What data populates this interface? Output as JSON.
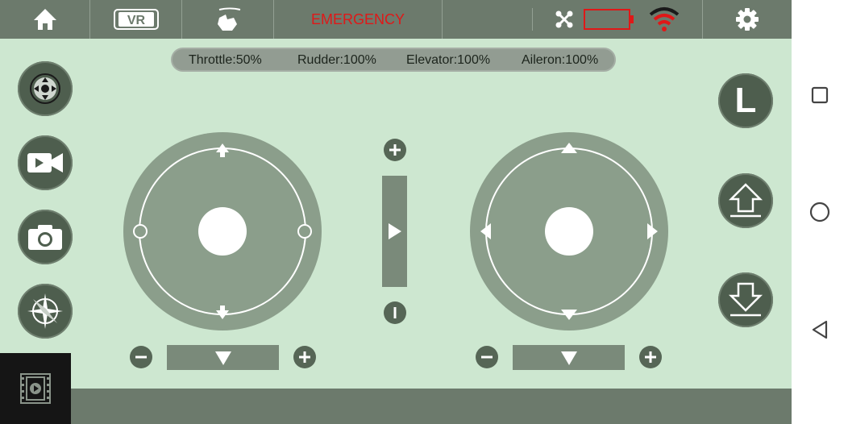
{
  "topbar": {
    "emergency_label": "EMERGENCY",
    "items": [
      "home-icon",
      "vr-icon",
      "gesture-icon",
      "drone-icon",
      "battery-icon",
      "wifi-icon",
      "settings-icon"
    ],
    "vr_label": "VR"
  },
  "status": {
    "throttle": "Throttle:50%",
    "rudder": "Rudder:100%",
    "elevator": "Elevator:100%",
    "aileron": "Aileron:100%"
  },
  "right_buttons": {
    "mode_label": "L"
  },
  "colors": {
    "background": "#cde7d0",
    "bar": "#6c7a6c",
    "button": "#4e5e4e",
    "joystick": "#8b9e8b",
    "emergency": "#e01818",
    "battery": "#e01818",
    "wifi": "#e01818"
  },
  "left_buttons": [
    "gyro-icon",
    "video-camera-icon",
    "photo-camera-icon",
    "compass-icon"
  ],
  "android_nav": [
    "recents-icon",
    "home-circle-icon",
    "back-icon"
  ]
}
